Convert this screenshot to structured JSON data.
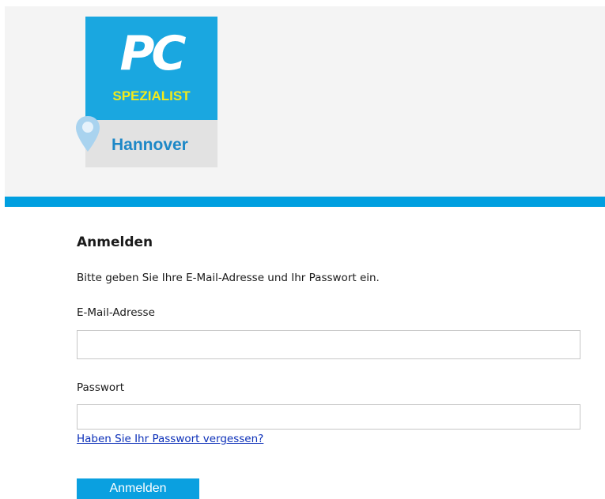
{
  "brand": {
    "logo_pc": "PC",
    "logo_subtitle": "SPEZIALIST",
    "logo_city": "Hannover",
    "colors": {
      "primary_blue": "#009fe0",
      "logo_yellow": "#f3ea1a",
      "city_blue": "#1d88c7"
    }
  },
  "login": {
    "title": "Anmelden",
    "intro": "Bitte geben Sie Ihre E-Mail-Adresse und Ihr Passwort ein.",
    "email_label": "E-Mail-Adresse",
    "email_value": "",
    "password_label": "Passwort",
    "password_value": "",
    "forgot_link": "Haben Sie Ihr Passwort vergessen?",
    "submit_label": "Anmelden"
  }
}
